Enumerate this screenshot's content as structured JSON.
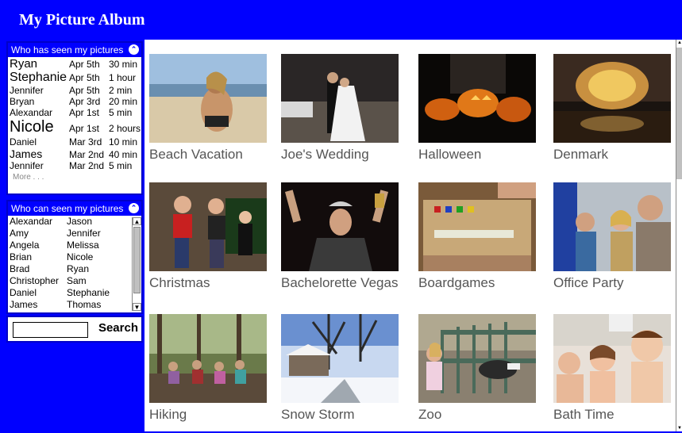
{
  "app": {
    "title": "My Picture Album"
  },
  "seen_panel": {
    "heading": "Who has seen my pictures",
    "rows": [
      {
        "name": "Ryan",
        "date": "Apr 5th",
        "time": "30 min",
        "size": 15
      },
      {
        "name": "Stephanie",
        "date": "Apr 5th",
        "time": "1 hour",
        "size": 16
      },
      {
        "name": "Jennifer",
        "date": "Apr 5th",
        "time": "2 min",
        "size": 12
      },
      {
        "name": "Bryan",
        "date": "Apr 3rd",
        "time": "20 min",
        "size": 12
      },
      {
        "name": "Alexandar",
        "date": "Apr 1st",
        "time": "5 min",
        "size": 12
      },
      {
        "name": "Nicole",
        "date": "Apr 1st",
        "time": "2 hours",
        "size": 20
      },
      {
        "name": "Daniel",
        "date": "Mar 3rd",
        "time": "10 min",
        "size": 12
      },
      {
        "name": "James",
        "date": "Mar 2nd",
        "time": "40 min",
        "size": 14
      },
      {
        "name": "Jennifer",
        "date": "Mar 2nd",
        "time": "5 min",
        "size": 12
      }
    ],
    "more": "More . . ."
  },
  "can_panel": {
    "heading": "Who can seen my pictures",
    "rows": [
      [
        "Alexandar",
        "Jason"
      ],
      [
        "Amy",
        "Jennifer"
      ],
      [
        "Angela",
        "Melissa"
      ],
      [
        "Brian",
        "Nicole"
      ],
      [
        "Brad",
        "Ryan"
      ],
      [
        "Christopher",
        "Sam"
      ],
      [
        "Daniel",
        "Stephanie"
      ],
      [
        "James",
        "Thomas"
      ]
    ]
  },
  "search": {
    "button": "Search",
    "value": ""
  },
  "albums": [
    {
      "caption": "Beach Vacation",
      "icon": "beach-photo"
    },
    {
      "caption": "Joe's Wedding",
      "icon": "wedding-photo"
    },
    {
      "caption": "Halloween",
      "icon": "halloween-photo"
    },
    {
      "caption": "Denmark",
      "icon": "denmark-photo"
    },
    {
      "caption": "Christmas",
      "icon": "christmas-photo"
    },
    {
      "caption": "Bachelorette Vegas",
      "icon": "vegas-photo"
    },
    {
      "caption": "Boardgames",
      "icon": "boardgames-photo"
    },
    {
      "caption": "Office Party",
      "icon": "office-party-photo"
    },
    {
      "caption": "Hiking",
      "icon": "hiking-photo"
    },
    {
      "caption": "Snow Storm",
      "icon": "snow-storm-photo"
    },
    {
      "caption": "Zoo",
      "icon": "zoo-photo"
    },
    {
      "caption": "Bath Time",
      "icon": "bath-time-photo"
    }
  ],
  "colors": {
    "brand": "#0000ff",
    "caption": "#555555"
  }
}
